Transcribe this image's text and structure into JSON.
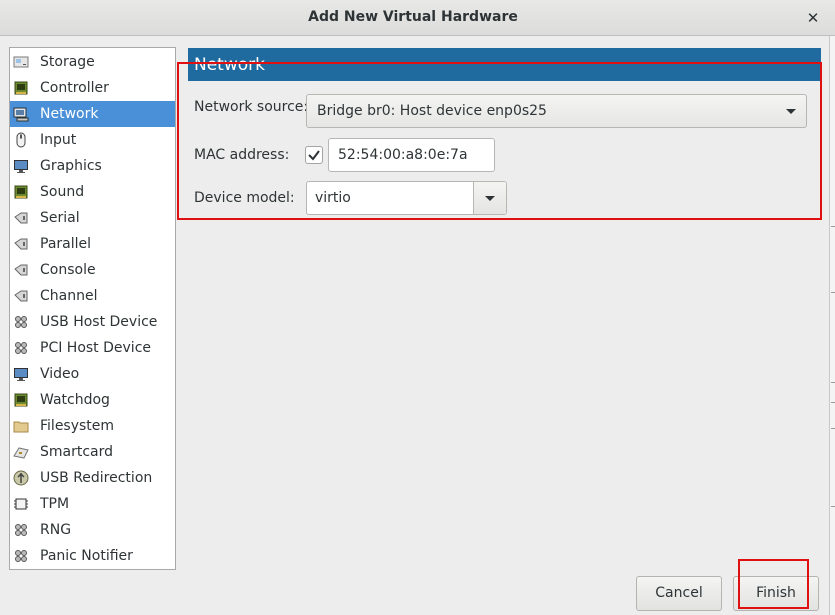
{
  "window": {
    "title": "Add New Virtual Hardware",
    "close_glyph": "✕"
  },
  "sidebar": {
    "selected_index": 2,
    "items": [
      {
        "label": "Storage",
        "icon": "storage-icon"
      },
      {
        "label": "Controller",
        "icon": "controller-icon"
      },
      {
        "label": "Network",
        "icon": "network-icon"
      },
      {
        "label": "Input",
        "icon": "mouse-icon"
      },
      {
        "label": "Graphics",
        "icon": "monitor-icon"
      },
      {
        "label": "Sound",
        "icon": "sound-card-icon"
      },
      {
        "label": "Serial",
        "icon": "serial-plug-icon"
      },
      {
        "label": "Parallel",
        "icon": "parallel-plug-icon"
      },
      {
        "label": "Console",
        "icon": "console-plug-icon"
      },
      {
        "label": "Channel",
        "icon": "channel-plug-icon"
      },
      {
        "label": "USB Host Device",
        "icon": "usb-device-icon"
      },
      {
        "label": "PCI Host Device",
        "icon": "pci-device-icon"
      },
      {
        "label": "Video",
        "icon": "video-monitor-icon"
      },
      {
        "label": "Watchdog",
        "icon": "watchdog-chip-icon"
      },
      {
        "label": "Filesystem",
        "icon": "folder-icon"
      },
      {
        "label": "Smartcard",
        "icon": "smartcard-icon"
      },
      {
        "label": "USB Redirection",
        "icon": "usb-redirection-icon"
      },
      {
        "label": "TPM",
        "icon": "tpm-chip-icon"
      },
      {
        "label": "RNG",
        "icon": "rng-icon"
      },
      {
        "label": "Panic Notifier",
        "icon": "panic-notifier-icon"
      }
    ]
  },
  "main": {
    "header": "Network",
    "network_source": {
      "label": "Network source:",
      "value": "Bridge br0: Host device enp0s25"
    },
    "mac_address": {
      "label": "MAC address:",
      "checked": true,
      "value": "52:54:00:a8:0e:7a"
    },
    "device_model": {
      "label": "Device model:",
      "value": "virtio"
    }
  },
  "buttons": {
    "cancel": "Cancel",
    "finish": "Finish"
  },
  "colors": {
    "selection": "#4a90d9",
    "header_bar": "#1f6ba0",
    "highlight_box": "#e01010"
  }
}
